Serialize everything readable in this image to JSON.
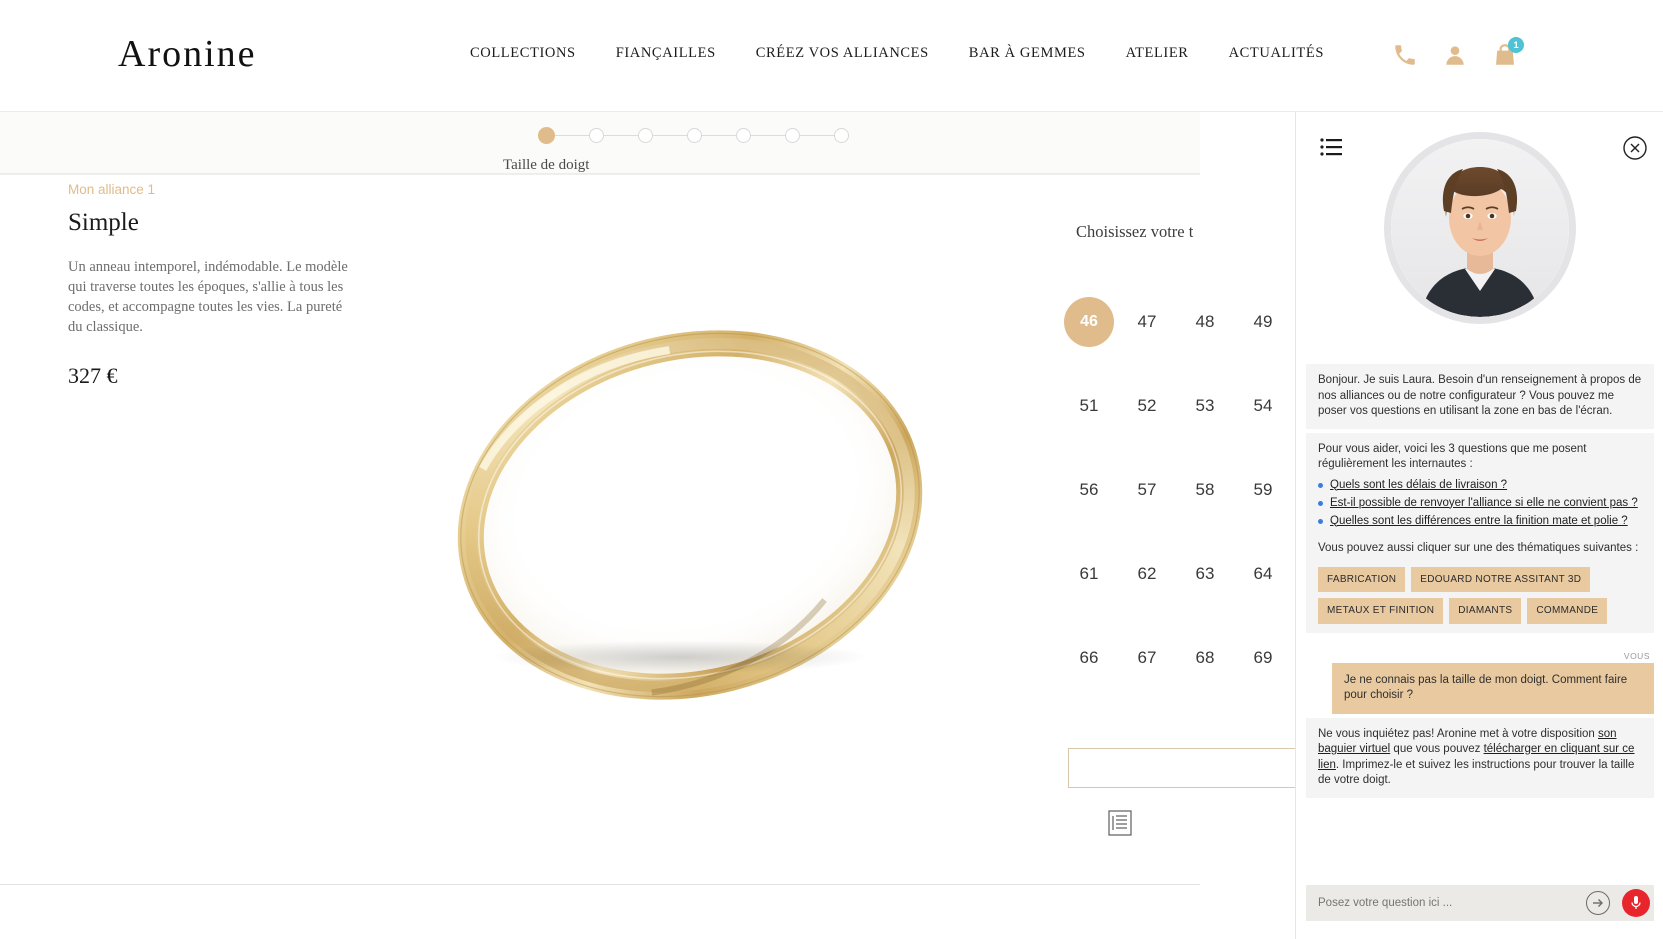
{
  "header": {
    "logo": "Aronine",
    "nav": [
      {
        "label": "COLLECTIONS"
      },
      {
        "label": "FIANÇAILLES"
      },
      {
        "label": "CRÉEZ VOS ALLIANCES"
      },
      {
        "label": "BAR À GEMMES"
      },
      {
        "label": "ATELIER"
      },
      {
        "label": "ACTUALITÉS"
      }
    ],
    "icons": {
      "phone": "phone-icon",
      "account": "user-icon",
      "cart": "shopping-bag-icon",
      "cart_count": "1"
    },
    "accent_color": "#e0bc8d",
    "badge_color": "#4ec3d4"
  },
  "stepper": {
    "total_steps": 7,
    "active_step": 1,
    "label": "Taille de doigt"
  },
  "product": {
    "eyebrow": "Mon alliance 1",
    "title": "Simple",
    "description": "Un anneau intemporel, indémodable. Le modèle qui traverse toutes les époques, s'allie à tous les codes, et accompagne toutes les vies. La pureté du classique.",
    "price": "327 €"
  },
  "sizes": {
    "heading": "Choisissez votre t",
    "selected": "46",
    "values": [
      "46",
      "47",
      "48",
      "49",
      "51",
      "52",
      "53",
      "54",
      "56",
      "57",
      "58",
      "59",
      "61",
      "62",
      "63",
      "64",
      "66",
      "67",
      "68",
      "69"
    ]
  },
  "chat": {
    "menu_icon": "list-icon",
    "close_icon": "close-icon",
    "avatar_name": "laura-avatar",
    "messages": [
      {
        "from": "bot",
        "text": "Bonjour. Je suis Laura. Besoin d'un renseignement à propos de nos alliances ou de notre configurateur ? Vous pouvez me poser vos questions en utilisant la zone en bas de l'écran."
      },
      {
        "from": "bot",
        "intro": "Pour vous aider, voici les 3 questions que me posent régulièrement les internautes :",
        "questions": [
          "Quels sont les délais de livraison ?",
          "Est-il possible de renvoyer l'alliance si elle ne convient pas ?",
          "Quelles sont les différences entre la finition mate et polie ?"
        ],
        "tags_intro": "Vous pouvez aussi cliquer sur une des thématiques suivantes :",
        "tags": [
          "FABRICATION",
          "EDOUARD NOTRE ASSITANT 3D",
          "METAUX ET FINITION",
          "DIAMANTS",
          "COMMANDE"
        ]
      },
      {
        "from": "user",
        "sender_label": "VOUS",
        "text": "Je ne connais pas la taille de mon doigt. Comment faire pour choisir ?"
      },
      {
        "from": "bot",
        "part1": "Ne vous inquiétez pas! Aronine met à votre disposition ",
        "link1": "son baguier virtuel",
        "part2": " que vous pouvez ",
        "link2": "télécharger en cliquant sur ce lien",
        "part3": ". Imprimez-le et suivez les instructions pour trouver la taille de votre doigt."
      }
    ],
    "input": {
      "placeholder": "Posez votre question ici ...",
      "value": "",
      "send_icon": "send-arrow-icon",
      "mic_icon": "microphone-icon",
      "mic_color": "#e8242c"
    }
  }
}
